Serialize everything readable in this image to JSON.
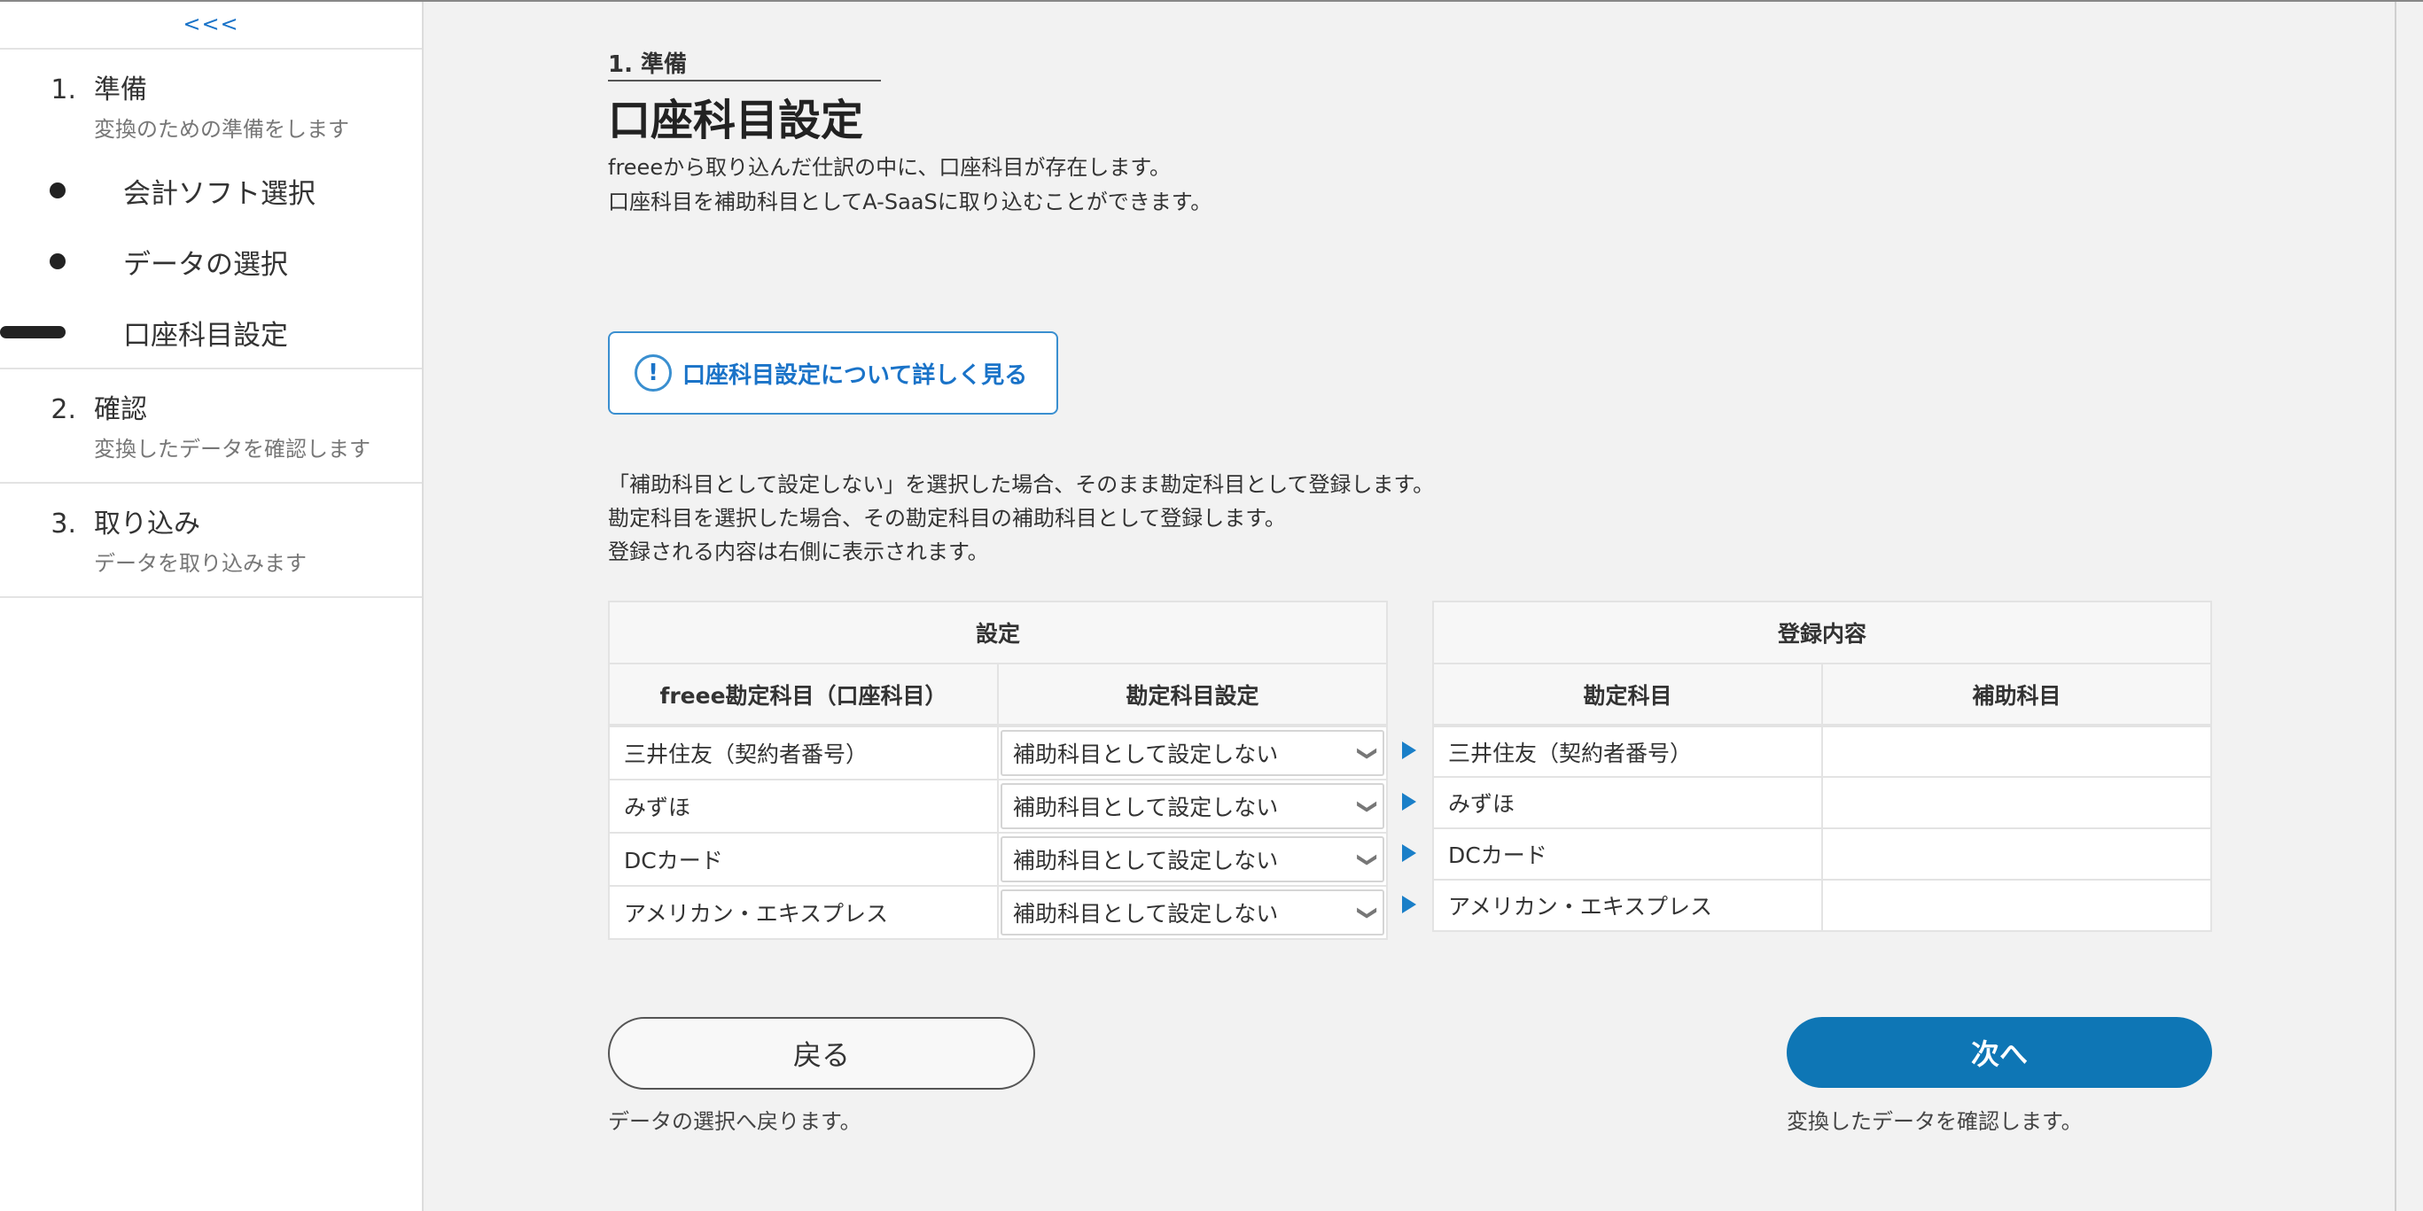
{
  "sidebar": {
    "collapse_label": "<<<",
    "steps": [
      {
        "number": "1.",
        "title": "準備",
        "subtitle": "変換のための準備をします",
        "items": [
          {
            "label": "会計ソフト選択",
            "state": "done"
          },
          {
            "label": "データの選択",
            "state": "done"
          },
          {
            "label": "口座科目設定",
            "state": "current"
          }
        ]
      },
      {
        "number": "2.",
        "title": "確認",
        "subtitle": "変換したデータを確認します"
      },
      {
        "number": "3.",
        "title": "取り込み",
        "subtitle": "データを取り込みます"
      }
    ]
  },
  "main": {
    "breadcrumb": "1. 準備",
    "title": "口座科目設定",
    "intro": [
      "freeeから取り込んだ仕訳の中に、口座科目が存在します。",
      "口座科目を補助科目としてA-SaaSに取り込むことができます。"
    ],
    "info_button": {
      "icon": "!",
      "label": "口座科目設定について詳しく見る"
    },
    "description": [
      "「補助科目として設定しない」を選択した場合、そのまま勘定科目として登録します。",
      "勘定科目を選択した場合、その勘定科目の補助科目として登録します。",
      "登録される内容は右側に表示されます。"
    ],
    "settings_table": {
      "group_header": "設定",
      "columns": [
        "freee勘定科目（口座科目）",
        "勘定科目設定"
      ],
      "rows": [
        {
          "account": "三井住友（契約者番号）",
          "setting": "補助科目として設定しない"
        },
        {
          "account": "みずほ",
          "setting": "補助科目として設定しない"
        },
        {
          "account": "DCカード",
          "setting": "補助科目として設定しない"
        },
        {
          "account": "アメリカン・エキスプレス",
          "setting": "補助科目として設定しない"
        }
      ]
    },
    "result_table": {
      "group_header": "登録内容",
      "columns": [
        "勘定科目",
        "補助科目"
      ],
      "rows": [
        {
          "account": "三井住友（契約者番号）",
          "sub": ""
        },
        {
          "account": "みずほ",
          "sub": ""
        },
        {
          "account": "DCカード",
          "sub": ""
        },
        {
          "account": "アメリカン・エキスプレス",
          "sub": ""
        }
      ]
    },
    "back_button": {
      "label": "戻る",
      "note": "データの選択へ戻ります。"
    },
    "next_button": {
      "label": "次へ",
      "note": "変換したデータを確認します。"
    }
  },
  "colors": {
    "accent": "#0e76b5",
    "link": "#1a73c8",
    "background": "#f2f2f2"
  }
}
